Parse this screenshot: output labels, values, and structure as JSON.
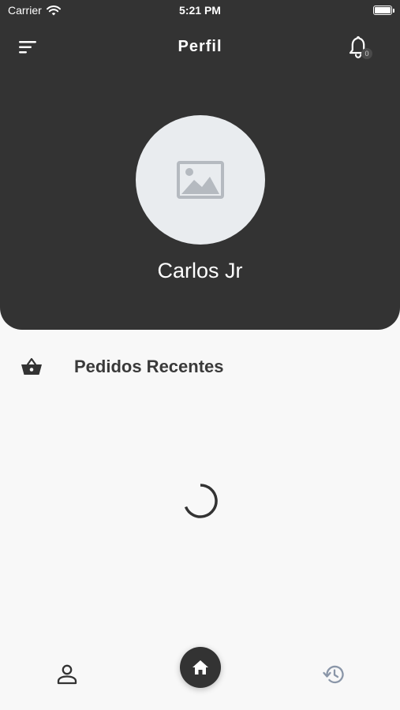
{
  "status_bar": {
    "carrier": "Carrier",
    "time": "5:21 PM",
    "wifi_icon": "wifi-icon",
    "battery_icon": "battery-icon",
    "battery_level": 1.0
  },
  "header": {
    "title": "Perfil",
    "menu_icon": "sort-lines-icon",
    "notification_icon": "bell-icon",
    "notification_count": "0",
    "background_color": "#333333"
  },
  "profile": {
    "avatar_icon": "image-placeholder-icon",
    "name": "Carlos Jr"
  },
  "recent_orders": {
    "icon": "shopping-basket-icon",
    "title": "Pedidos Recentes",
    "loading": true
  },
  "bottom_nav": {
    "items": [
      {
        "icon": "person-outline-icon",
        "active": false
      },
      {
        "icon": "home-icon",
        "active": true
      },
      {
        "icon": "history-icon",
        "active": false
      }
    ]
  }
}
